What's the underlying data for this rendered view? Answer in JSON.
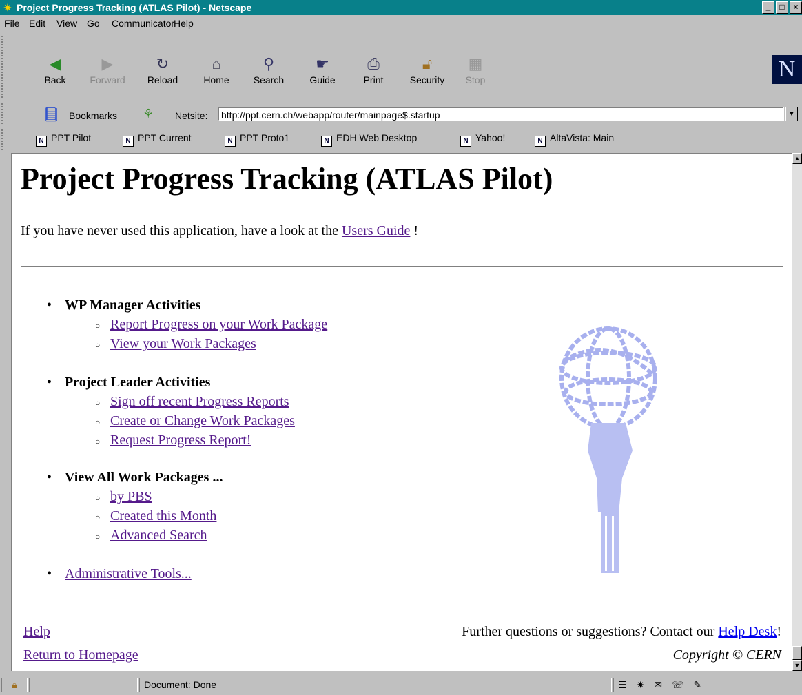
{
  "window": {
    "title": "Project Progress Tracking (ATLAS Pilot) - Netscape",
    "minimize": "_",
    "maximize": "□",
    "close": "×"
  },
  "menu": [
    "File",
    "Edit",
    "View",
    "Go",
    "Communicator",
    "Help"
  ],
  "toolbar": {
    "back": "Back",
    "forward": "Forward",
    "reload": "Reload",
    "home": "Home",
    "search": "Search",
    "guide": "Guide",
    "print": "Print",
    "security": "Security",
    "stop": "Stop",
    "logo": "N"
  },
  "location": {
    "bookmarks_label": "Bookmarks",
    "netsite_label": "Netsite:",
    "url": "http://ppt.cern.ch/webapp/router/mainpage$.startup"
  },
  "personal_toolbar": [
    "PPT Pilot",
    "PPT Current",
    "PPT Proto1",
    "EDH Web Desktop",
    "Yahoo!",
    "AltaVista: Main"
  ],
  "page": {
    "heading": "Project Progress Tracking (ATLAS Pilot)",
    "intro_text": "If you have never used this application, have a look at the",
    "intro_link": "Users Guide",
    "intro_end": "!",
    "sections": [
      {
        "title": "WP Manager Activities",
        "links": [
          "Report Progress on your Work Package",
          "View your Work Packages"
        ]
      },
      {
        "title": "Project Leader Activities",
        "links": [
          "Sign off recent Progress Reports",
          "Create or Change Work Packages",
          "Request Progress Report!"
        ]
      },
      {
        "title": "View All Work Packages ...",
        "links": [
          "by PBS",
          "Created this Month",
          "Advanced Search"
        ]
      }
    ],
    "admin_link": "Administrative Tools...",
    "footer": {
      "help": "Help",
      "return": "Return to Homepage",
      "questions": "Further questions or suggestions? Contact our",
      "helpdesk": "Help Desk",
      "questions_end": "!",
      "copyright": "Copyright © CERN"
    }
  },
  "status": {
    "text": "Document: Done"
  }
}
